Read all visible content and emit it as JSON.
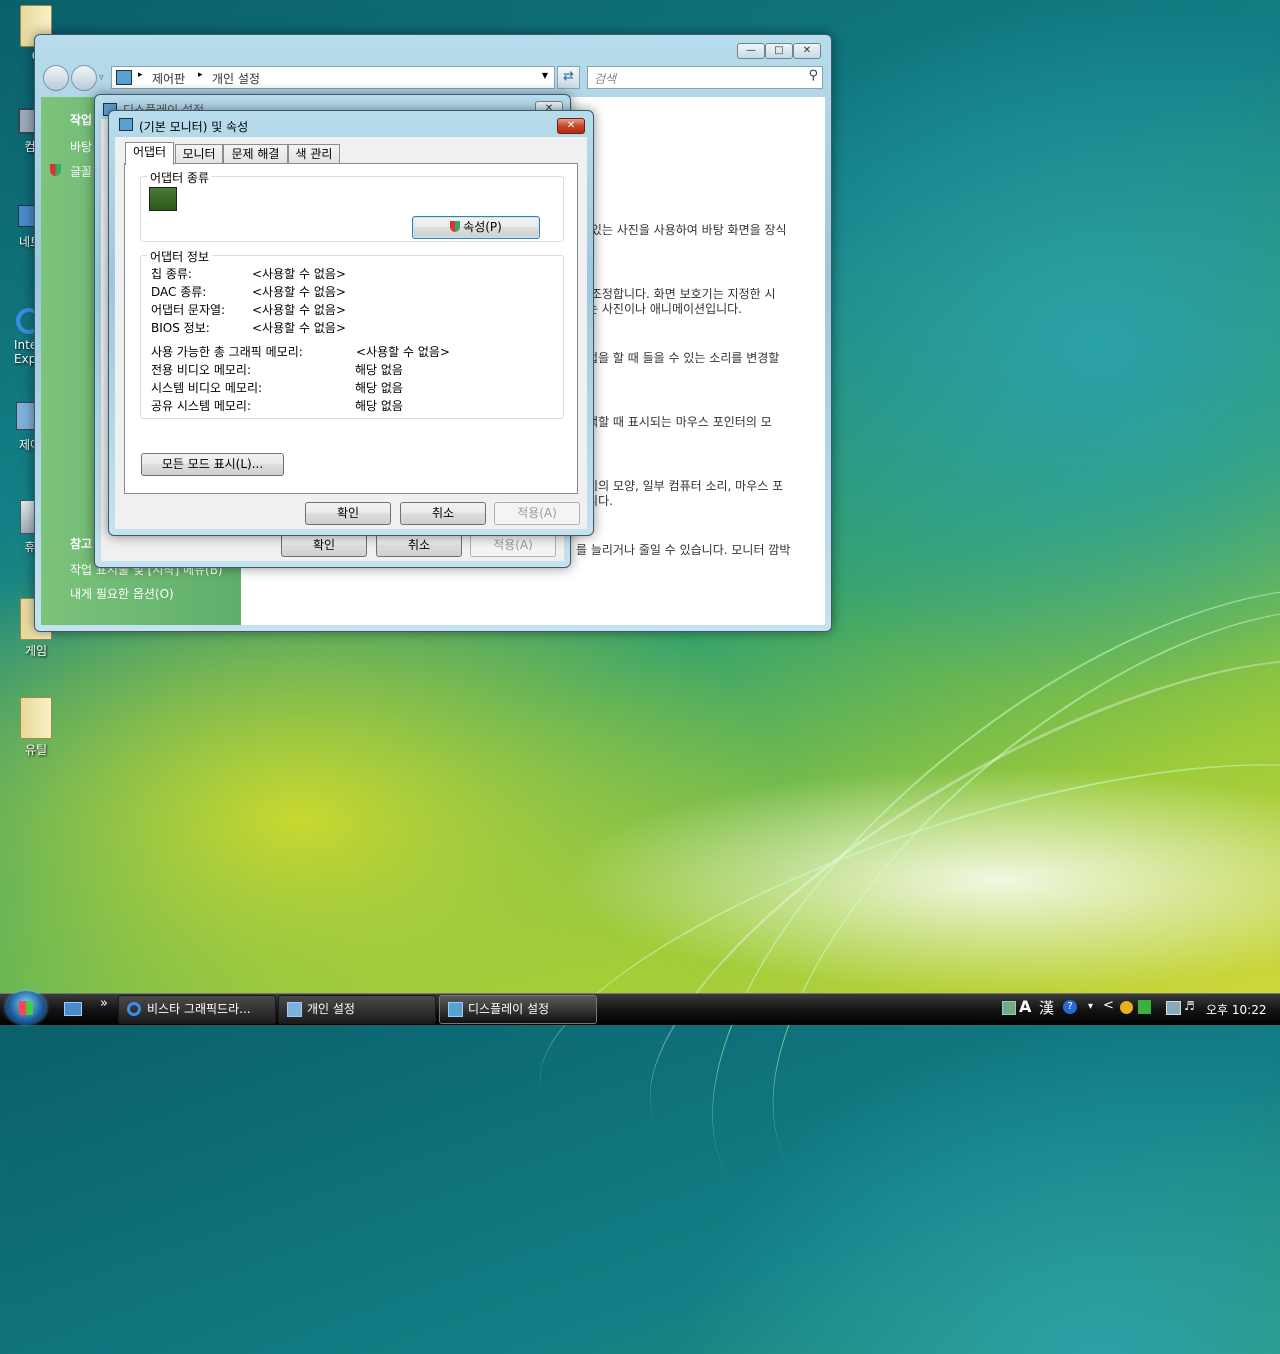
{
  "desktop": {
    "icons": [
      {
        "label": "C",
        "icon": "folder-icon"
      },
      {
        "label": "컴",
        "icon": "computer-icon"
      },
      {
        "label": "네트",
        "icon": "network-icon"
      },
      {
        "label": "Inte\nExp",
        "icon": "internet-explorer-icon"
      },
      {
        "label": "제어",
        "icon": "control-panel-icon"
      },
      {
        "label": "휴",
        "icon": "recycle-bin-icon"
      },
      {
        "label": "게임",
        "icon": "folder-icon"
      },
      {
        "label": "유틸",
        "icon": "folder-icon"
      }
    ]
  },
  "explorer": {
    "breadcrumb": [
      "제어판",
      "개인 설정"
    ],
    "search_placeholder": "검색",
    "sidebar": {
      "tasks_title": "작업",
      "tasks": [
        "바탕",
        "글꼴"
      ],
      "see_also_title": "참고",
      "see_also": [
        "작업 표시줄 및 [시작] 메뉴(B)",
        "내게 필요한 옵션(O)"
      ]
    },
    "content_lines": [
      "고 있는 사진을 사용하여 바탕 화면을 장식",
      "을 조정합니다. 화면 보호기는 지정한 시",
      "나는 사진이나 애니메이션입니다.",
      "작업을 할 때 들을 수 있는 소리를 변경할",
      "선택할 때 표시되는 마우스 포인터의 모",
      "트기의 모양, 일부 컴퓨터 소리, 마우스 포",
      "습니다.",
      "를 늘리거나 줄일 수 있습니다. 모니터 깜박"
    ]
  },
  "display_settings": {
    "title": "디스플레이 설정",
    "ok": "확인",
    "cancel": "취소",
    "apply": "적용(A)"
  },
  "properties_dialog": {
    "title": "(기본 모니터) 및  속성",
    "tabs": [
      "어댑터",
      "모니터",
      "문제 해결",
      "색 관리"
    ],
    "adapter_type_group": "어댑터 종류",
    "properties_button": "속성(P)",
    "adapter_info_group": "어댑터 정보",
    "info": [
      {
        "label": "칩 종류:",
        "value": "<사용할 수 없음>"
      },
      {
        "label": "DAC 종류:",
        "value": "<사용할 수 없음>"
      },
      {
        "label": "어댑터 문자열:",
        "value": "<사용할 수 없음>"
      },
      {
        "label": "BIOS 정보:",
        "value": "<사용할 수 없음>"
      }
    ],
    "memory": [
      {
        "label": "사용 가능한 총 그래픽 메모리:",
        "value": "<사용할 수 없음>"
      },
      {
        "label": "전용 비디오 메모리:",
        "value": "해당 없음"
      },
      {
        "label": "시스템 비디오 메모리:",
        "value": "해당 없음"
      },
      {
        "label": "공유 시스템 메모리:",
        "value": "해당 없음"
      }
    ],
    "list_modes_button": "모든 모드 표시(L)...",
    "ok": "확인",
    "cancel": "취소",
    "apply": "적용(A)"
  },
  "taskbar": {
    "quick_launch_more": "»",
    "buttons": [
      {
        "label": "비스타 그래픽드라...",
        "icon": "internet-explorer-icon"
      },
      {
        "label": "개인 설정",
        "icon": "control-panel-icon"
      },
      {
        "label": "디스플레이 설정",
        "icon": "display-settings-icon"
      }
    ],
    "tray": {
      "ime_a": "A",
      "ime_han": "漢",
      "help": "?",
      "chevron": "<",
      "clock": "오후 10:22"
    }
  }
}
